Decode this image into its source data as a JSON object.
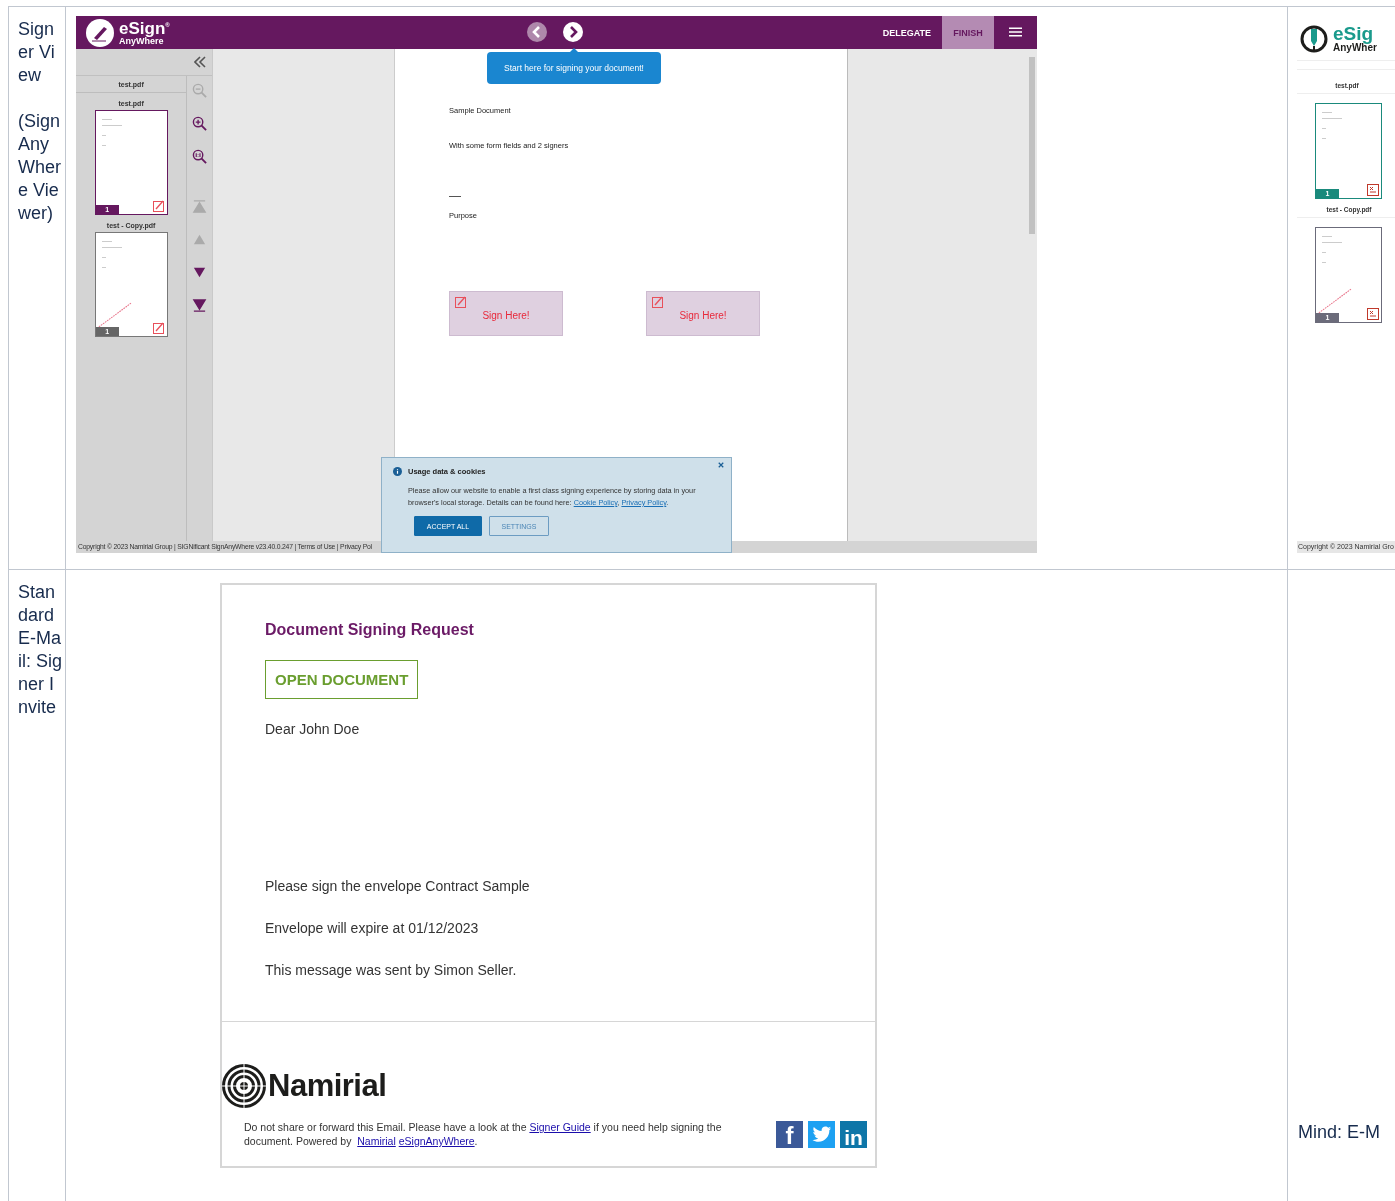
{
  "table": {
    "rows": [
      {
        "label": [
          "Signer View",
          "(SignAnyWhere Viewer)"
        ]
      },
      {
        "label": [
          "Standard E-Mail: Signer Invite"
        ]
      }
    ]
  },
  "viewer": {
    "logo": {
      "name": "eSign",
      "sub": "AnyWhere",
      "mark": "®"
    },
    "nav": [
      {
        "kind": "prev",
        "disabled": true
      },
      {
        "kind": "next",
        "disabled": false
      }
    ],
    "actions": [
      {
        "label": "DELEGATE",
        "kind": "plain"
      },
      {
        "label": "FINISH",
        "kind": "highlight"
      }
    ],
    "tooltip": "Start here for signing your document!",
    "sidebar": {
      "header": "test.pdf",
      "documents": [
        {
          "name": "test.pdf",
          "page": "1",
          "selected": true,
          "signed": false
        },
        {
          "name": "test - Copy.pdf",
          "page": "1",
          "selected": false,
          "signed": true
        }
      ]
    },
    "tools": [
      {
        "kind": "zoom-out",
        "disabled": true
      },
      {
        "kind": "zoom-in",
        "disabled": false
      },
      {
        "kind": "zoom-reset",
        "disabled": false
      },
      {
        "kind": "first",
        "disabled": true
      },
      {
        "kind": "up",
        "disabled": true
      },
      {
        "kind": "down",
        "disabled": false
      },
      {
        "kind": "last",
        "disabled": false
      }
    ],
    "document": {
      "lines": [
        {
          "kind": "text",
          "text": "Sample Document"
        },
        {
          "kind": "text",
          "text": "With some form fields and 2 signers"
        },
        {
          "kind": "rule"
        },
        {
          "kind": "text",
          "text": "Purpose"
        }
      ],
      "sign_fields": [
        "Sign Here!",
        "Sign Here!"
      ]
    },
    "cookie": {
      "title": "Usage data & cookies",
      "parts": [
        {
          "text": "Please allow our website to enable a first class signing experience by storing data in your browser's local storage. Details can be found here: "
        },
        {
          "link": "Cookie Policy"
        },
        {
          "text": ", "
        },
        {
          "link": "Privacy Policy"
        },
        {
          "text": "."
        }
      ],
      "buttons": [
        {
          "label": "ACCEPT ALL",
          "kind": "primary"
        },
        {
          "label": "SETTINGS",
          "kind": "secondary"
        }
      ]
    },
    "footer": "Copyright © 2023 Namirial Group | SIGNificant SignAnyWhere v23.40.0.247 | Terms of Use | Privacy Pol"
  },
  "email": {
    "title": "Document Signing Request",
    "button": "OPEN DOCUMENT",
    "greeting": "Dear John Doe",
    "paragraphs": [
      "Please sign the envelope Contract Sample",
      "Envelope will expire at 01/12/2023",
      "This message was sent by Simon Seller."
    ],
    "brand": "Namirial",
    "footer_parts": [
      {
        "text": "Do not share or forward this Email. Please have a look at the "
      },
      {
        "link": "Signer Guide"
      },
      {
        "text": " if you need help signing the document. Powered by "
      },
      {
        "link": "Namirial"
      },
      {
        "link": "eSignAnyWhere"
      },
      {
        "text": "."
      }
    ],
    "social": [
      {
        "kind": "facebook",
        "glyph": "f"
      },
      {
        "kind": "twitter"
      },
      {
        "kind": "linkedin",
        "glyph": "in"
      }
    ]
  },
  "side_viewer": {
    "logo": {
      "name": "eSig",
      "sub": "AnyWher"
    },
    "header": "test.pdf",
    "documents": [
      {
        "name": "test - Copy.pdf",
        "page": "1",
        "selected": false,
        "signed": true
      }
    ],
    "first_page": {
      "page": "1",
      "selected": true,
      "signed": false
    },
    "footer": "Copyright © 2023 Namirial Gro"
  },
  "side_note": "Mind: E-M"
}
